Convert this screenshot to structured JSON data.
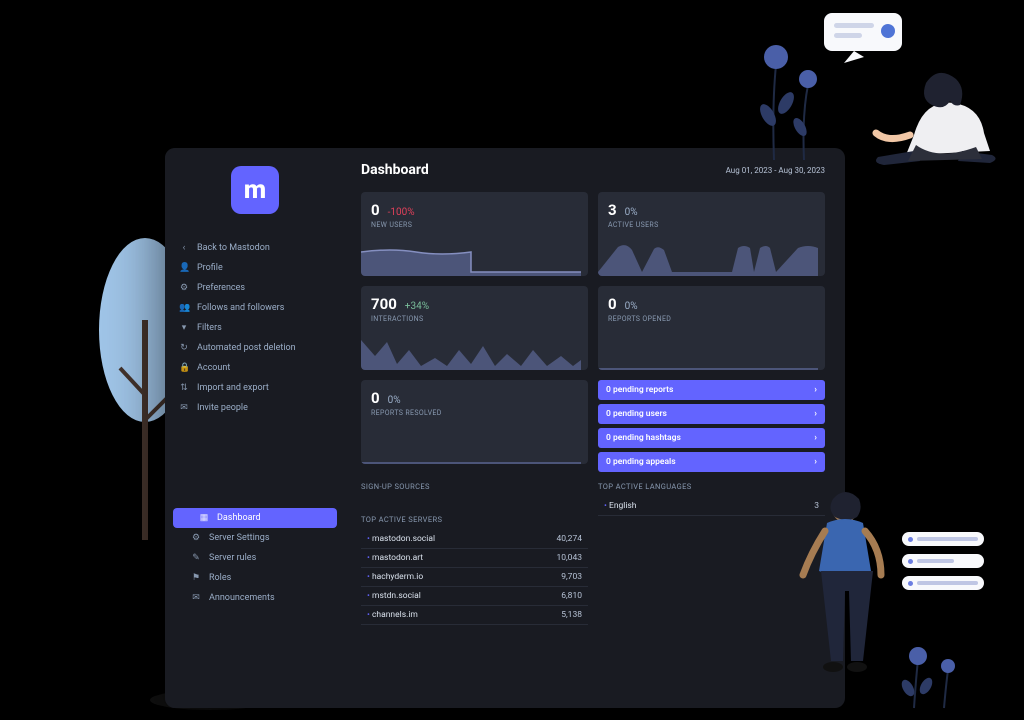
{
  "header": {
    "title": "Dashboard",
    "date_range": "Aug 01, 2023 - Aug 30, 2023"
  },
  "sidebar": {
    "items": [
      {
        "icon": "‹",
        "label": "Back to Mastodon"
      },
      {
        "icon": "👤",
        "label": "Profile"
      },
      {
        "icon": "⚙",
        "label": "Preferences"
      },
      {
        "icon": "👥",
        "label": "Follows and followers"
      },
      {
        "icon": "▾",
        "label": "Filters"
      },
      {
        "icon": "↻",
        "label": "Automated post deletion"
      },
      {
        "icon": "🔒",
        "label": "Account"
      },
      {
        "icon": "⇅",
        "label": "Import and export"
      },
      {
        "icon": "✉",
        "label": "Invite people"
      }
    ],
    "admin_items": [
      {
        "icon": "▦",
        "label": "Dashboard",
        "active": true
      },
      {
        "icon": "⚙",
        "label": "Server Settings"
      },
      {
        "icon": "✎",
        "label": "Server rules"
      },
      {
        "icon": "⚑",
        "label": "Roles"
      },
      {
        "icon": "✉",
        "label": "Announcements"
      }
    ]
  },
  "cards": {
    "new_users": {
      "value": "0",
      "delta": "-100%",
      "delta_dir": "down",
      "label": "NEW USERS"
    },
    "active_users": {
      "value": "3",
      "delta": "0%",
      "delta_dir": "",
      "label": "ACTIVE USERS"
    },
    "interactions": {
      "value": "700",
      "delta": "+34%",
      "delta_dir": "up",
      "label": "INTERACTIONS"
    },
    "reports_opened": {
      "value": "0",
      "delta": "0%",
      "delta_dir": "",
      "label": "REPORTS OPENED"
    },
    "reports_resolved": {
      "value": "0",
      "delta": "0%",
      "delta_dir": "",
      "label": "REPORTS RESOLVED"
    }
  },
  "pending": [
    "0 pending reports",
    "0 pending users",
    "0 pending hashtags",
    "0 pending appeals"
  ],
  "sections": {
    "signup_sources": "SIGN-UP SOURCES",
    "top_languages": "TOP ACTIVE LANGUAGES",
    "top_servers": "TOP ACTIVE SERVERS"
  },
  "languages": [
    {
      "name": "English",
      "count": "3"
    }
  ],
  "servers": [
    {
      "name": "mastodon.social",
      "count": "40,274"
    },
    {
      "name": "mastodon.art",
      "count": "10,043"
    },
    {
      "name": "hachyderm.io",
      "count": "9,703"
    },
    {
      "name": "mstdn.social",
      "count": "6,810"
    },
    {
      "name": "channels.im",
      "count": "5,138"
    }
  ]
}
